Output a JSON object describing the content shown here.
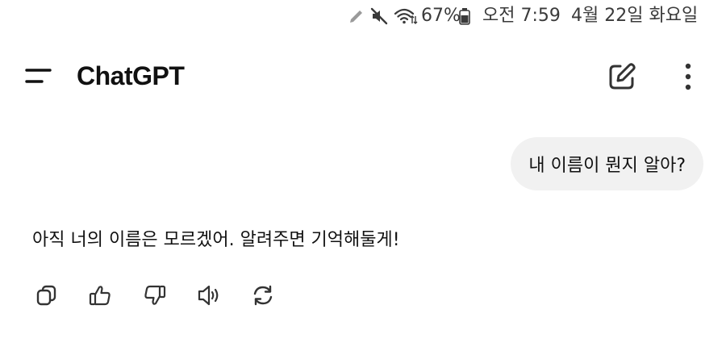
{
  "status_bar": {
    "battery_percent": "67%",
    "time": "오전 7:59",
    "date": "4월 22일 화요일",
    "icons": [
      "pencil-icon",
      "mute-icon",
      "wifi-icon",
      "battery-icon"
    ]
  },
  "header": {
    "title": "ChatGPT",
    "icons": [
      "menu-icon",
      "edit-icon",
      "more-vert-icon"
    ]
  },
  "conversation": {
    "user_message": "내 이름이 뭔지 알아?",
    "assistant_message": "아직 너의 이름은 모르겠어. 알려주면 기억해둘게!"
  },
  "message_actions": {
    "icons": [
      "copy-icon",
      "thumbs-up-icon",
      "thumbs-down-icon",
      "speaker-icon",
      "regenerate-icon"
    ]
  },
  "colors": {
    "background": "#ffffff",
    "bubble": "#f1f1f1",
    "text": "#111111",
    "icon": "#333333"
  }
}
